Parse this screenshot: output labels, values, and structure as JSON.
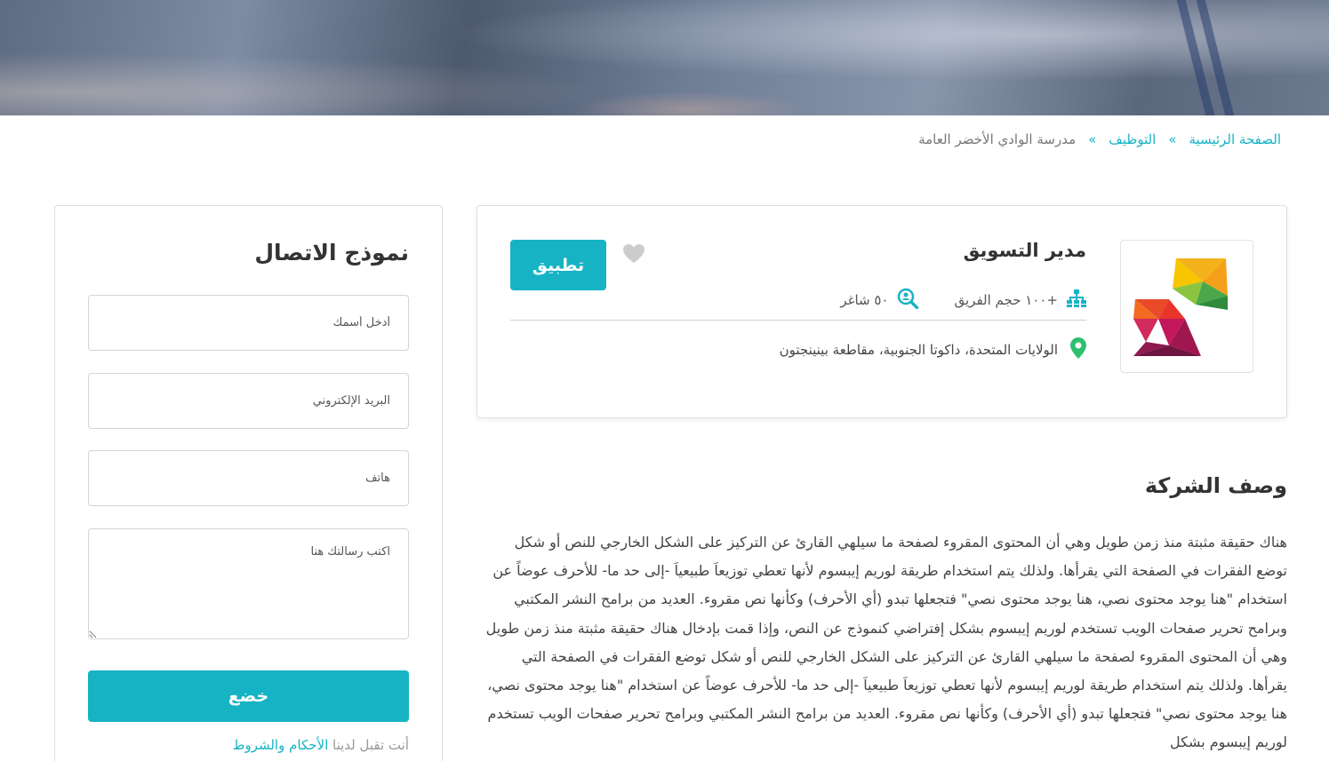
{
  "breadcrumb": {
    "home": "الصفحة الرئيسية",
    "jobs": "التوظيف",
    "current": "مدرسة الوادي الأخضر العامة",
    "separator": "»"
  },
  "job": {
    "title": "مدير التسويق",
    "apply_label": "تطبيق",
    "team_size": "+١٠٠ حجم الفريق",
    "vacancies": "٥٠ شاغر",
    "location": "الولايات المتحدة، داكوتا الجنوبية، مقاطعة بينينجتون"
  },
  "description": {
    "title": "وصف الشركة",
    "body": "هناك حقيقة مثبتة منذ زمن طويل وهي أن المحتوى المقروء لصفحة ما سيلهي القارئ عن التركيز على الشكل الخارجي للنص أو شكل توضع الفقرات في الصفحة التي يقرأها. ولذلك يتم استخدام طريقة لوريم إيبسوم لأنها تعطي توزيعاَ طبيعياَ -إلى حد ما- للأحرف عوضاً عن استخدام \"هنا يوجد محتوى نصي، هنا يوجد محتوى نصي\" فتجعلها تبدو (أي الأحرف) وكأنها نص مقروء. العديد من برامح النشر المكتبي وبرامح تحرير صفحات الويب تستخدم لوريم إيبسوم بشكل إفتراضي كنموذج عن النص، وإذا قمت بإدخال هناك حقيقة مثبتة منذ زمن طويل وهي أن المحتوى المقروء لصفحة ما سيلهي القارئ عن التركيز على الشكل الخارجي للنص أو شكل توضع الفقرات في الصفحة التي يقرأها. ولذلك يتم استخدام طريقة لوريم إيبسوم لأنها تعطي توزيعاَ طبيعياَ -إلى حد ما- للأحرف عوضاً عن استخدام \"هنا يوجد محتوى نصي، هنا يوجد محتوى نصي\" فتجعلها تبدو (أي الأحرف) وكأنها نص مقروء. العديد من برامح النشر المكتبي وبرامح تحرير صفحات الويب تستخدم لوريم إيبسوم بشكل"
  },
  "contact": {
    "title": "نموذج الاتصال",
    "name_placeholder": "أدخل أسمك",
    "email_placeholder": "البريد الإلكتروني",
    "phone_placeholder": "هاتف",
    "message_placeholder": "اكتب رسالتك هنا",
    "submit_label": "خضع",
    "terms_prefix": "أنت تقبل لدينا ",
    "terms_link": "الأحكام والشروط"
  },
  "colors": {
    "accent": "#16b3c5",
    "location_pin": "#2ebf6f",
    "heart": "#cccccc"
  }
}
